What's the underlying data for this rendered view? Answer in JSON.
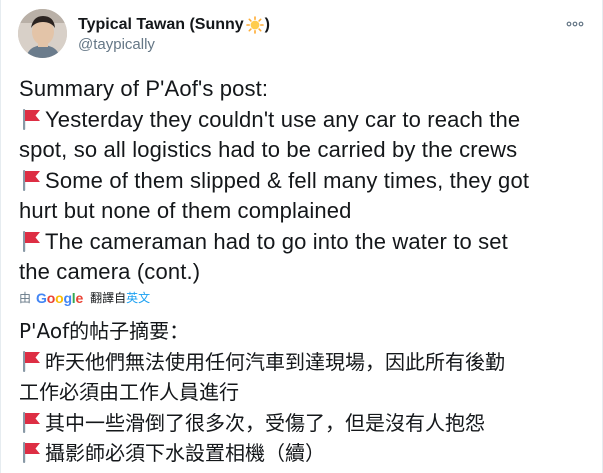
{
  "author": {
    "display_name": "Typical Tawan (Sunny",
    "display_name_suffix": ")",
    "handle": "@taypically",
    "sun_icon": "sun-emoji-icon"
  },
  "more_icon": "more-dots-icon",
  "tweet": {
    "lines": [
      {
        "flag": false,
        "text": "Summary of P'Aof's post:"
      },
      {
        "flag": true,
        "text": "Yesterday they couldn't use any car to reach the"
      },
      {
        "flag": false,
        "text": "spot, so all logistics had to be carried by the crews"
      },
      {
        "flag": true,
        "text": "Some of them slipped & fell many times, they got"
      },
      {
        "flag": false,
        "text": "hurt but none of them complained"
      },
      {
        "flag": true,
        "text": "The cameraman had to go into the water to set"
      },
      {
        "flag": false,
        "text": "the camera (cont.)"
      }
    ]
  },
  "translation": {
    "by_label": "由",
    "google": [
      "G",
      "o",
      "o",
      "g",
      "l",
      "e"
    ],
    "translated_from_label": "翻譯自",
    "language": "英文"
  },
  "translated": {
    "lines": [
      {
        "flag": false,
        "text": "P'Aof的帖子摘要："
      },
      {
        "flag": true,
        "text": "昨天他們無法使用任何汽車到達現場，因此所有後勤"
      },
      {
        "flag": false,
        "text": "工作必須由工作人員進行"
      },
      {
        "flag": true,
        "text": "其中一些滑倒了很多次，受傷了，但是沒有人抱怨"
      },
      {
        "flag": true,
        "text": "攝影師必須下水設置相機（續）"
      }
    ]
  },
  "colors": {
    "flag_red": "#dd2e44",
    "flag_pole": "#8899a6",
    "link_blue": "#1da1f2",
    "muted": "#657786"
  }
}
